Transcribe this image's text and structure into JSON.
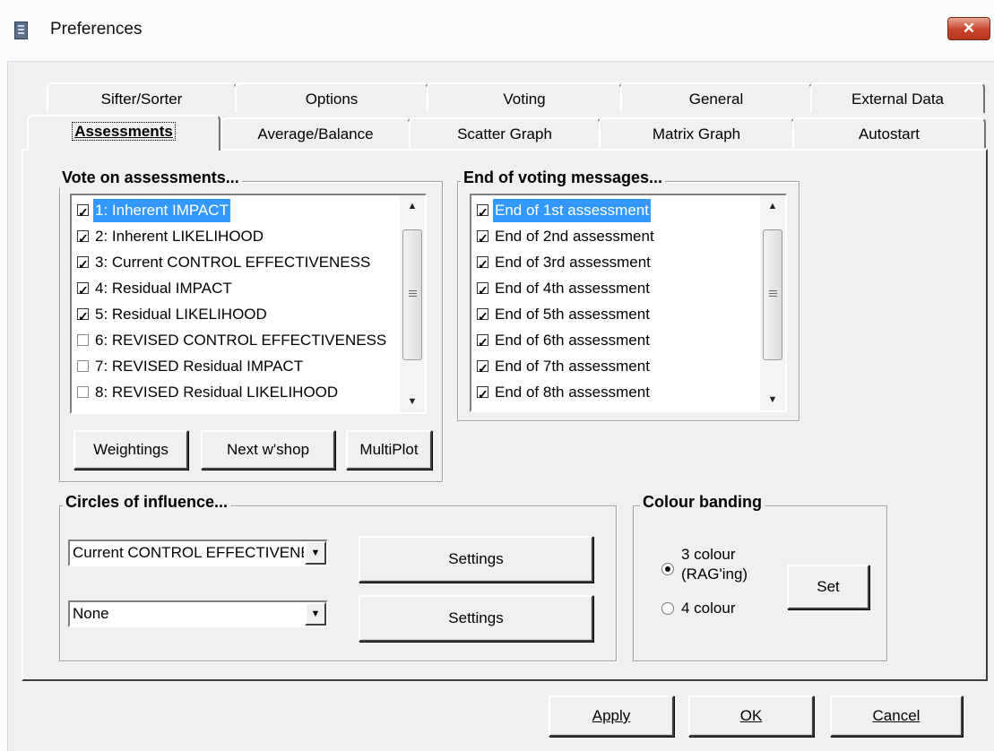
{
  "window": {
    "title": "Preferences",
    "close_label": "✕"
  },
  "tabs_back": [
    {
      "label": "Sifter/Sorter"
    },
    {
      "label": "Options"
    },
    {
      "label": "Voting"
    },
    {
      "label": "General"
    },
    {
      "label": "External Data"
    }
  ],
  "tabs_front": [
    {
      "label": "Assessments"
    },
    {
      "label": "Average/Balance"
    },
    {
      "label": "Scatter Graph"
    },
    {
      "label": "Matrix Graph"
    },
    {
      "label": "Autostart"
    }
  ],
  "vote": {
    "title": "Vote on assessments...",
    "items": [
      {
        "label": "1: Inherent IMPACT",
        "checked": true,
        "selected": true
      },
      {
        "label": "2: Inherent LIKELIHOOD",
        "checked": true
      },
      {
        "label": "3: Current CONTROL EFFECTIVENESS",
        "checked": true
      },
      {
        "label": "4: Residual IMPACT",
        "checked": true
      },
      {
        "label": "5: Residual LIKELIHOOD",
        "checked": true
      },
      {
        "label": "6: REVISED CONTROL EFFECTIVENESS",
        "checked": false
      },
      {
        "label": "7: REVISED Residual IMPACT",
        "checked": false
      },
      {
        "label": "8: REVISED Residual LIKELIHOOD",
        "checked": false
      }
    ],
    "buttons": {
      "weightings": "Weightings",
      "next_workshop": "Next w'shop",
      "multiplot": "MultiPlot"
    }
  },
  "end_msgs": {
    "title": "End of voting messages...",
    "items": [
      {
        "label": "End of 1st assessment",
        "checked": true,
        "selected": true
      },
      {
        "label": "End of 2nd assessment",
        "checked": true
      },
      {
        "label": "End of 3rd assessment",
        "checked": true
      },
      {
        "label": "End of 4th assessment",
        "checked": true
      },
      {
        "label": "End of 5th assessment",
        "checked": true
      },
      {
        "label": "End of 6th assessment",
        "checked": true
      },
      {
        "label": "End of 7th assessment",
        "checked": true
      },
      {
        "label": "End of 8th assessment",
        "checked": true
      }
    ]
  },
  "circles": {
    "title": "Circles of influence...",
    "combo1": "Current CONTROL EFFECTIVENESS",
    "combo2": "None",
    "settings1": "Settings",
    "settings2": "Settings"
  },
  "banding": {
    "title": "Colour banding",
    "option1_line1": "3 colour",
    "option1_line2": "(RAG'ing)",
    "option2": "4 colour",
    "selected": 1,
    "set_label": "Set"
  },
  "footer": {
    "apply": "Apply",
    "ok": "OK",
    "cancel": "Cancel"
  }
}
